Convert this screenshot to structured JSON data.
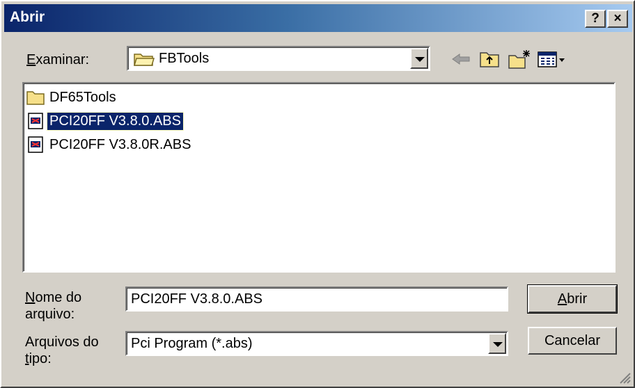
{
  "title": "Abrir",
  "title_buttons": {
    "help": "?",
    "close": "×"
  },
  "look_in": {
    "label_first": "E",
    "label_rest": "xaminar:",
    "value": "FBTools"
  },
  "toolbar": {
    "icons": [
      "back-arrow-icon",
      "up-folder-icon",
      "new-folder-icon",
      "view-menu-icon"
    ]
  },
  "files": [
    {
      "name": "DF65Tools",
      "type": "folder",
      "selected": false
    },
    {
      "name": "PCI20FF V3.8.0.ABS",
      "type": "abs-file",
      "selected": true
    },
    {
      "name": "PCI20FF V3.8.0R.ABS",
      "type": "abs-file",
      "selected": false
    }
  ],
  "filename": {
    "label_line1_first": "N",
    "label_line1_rest": "ome do",
    "label_line2": "arquivo:",
    "value": "PCI20FF V3.8.0.ABS"
  },
  "filetype": {
    "label_line1": "Arquivos do",
    "label_line2_first": "t",
    "label_line2_rest": "ipo:",
    "value": "Pci Program (*.abs)"
  },
  "buttons": {
    "open_first": "A",
    "open_rest": "brir",
    "cancel": "Cancelar"
  },
  "colors": {
    "titlebar_start": "#0a246a",
    "titlebar_end": "#a6caf0",
    "selection": "#0a246a",
    "face": "#d4d0c8"
  }
}
